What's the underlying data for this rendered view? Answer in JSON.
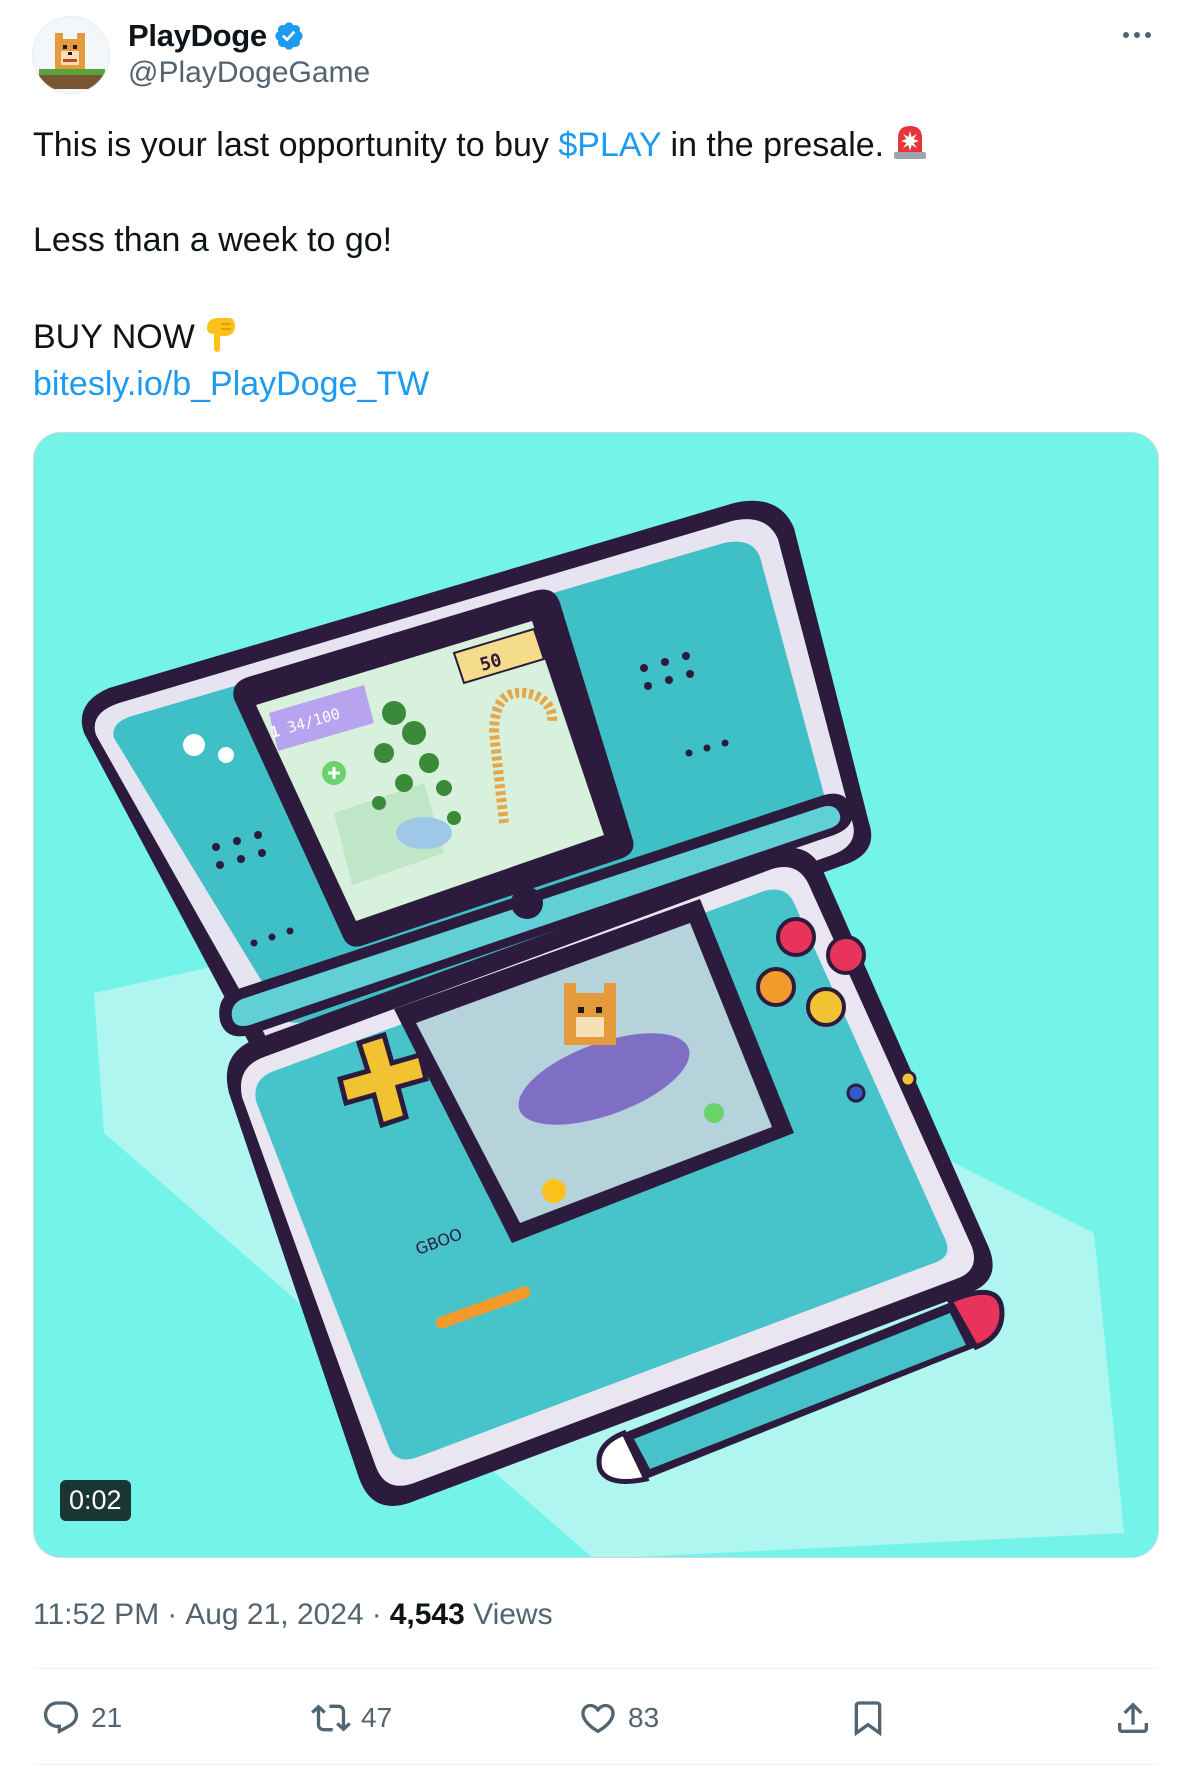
{
  "author": {
    "display_name": "PlayDoge",
    "handle": "@PlayDogeGame",
    "verified": true,
    "avatar_icon": "pixel-doge-avatar"
  },
  "post": {
    "line1_before": "This is your last opportunity to buy ",
    "line1_cashtag": "$PLAY",
    "line1_after": " in the presale.",
    "line1_emoji": "rotating-light-icon",
    "line2": "Less than a week to go!",
    "line3": "BUY NOW",
    "line3_emoji": "pointing-down-icon",
    "link": "bitesly.io/b_PlayDoge_TW"
  },
  "media": {
    "type": "video",
    "duration": "0:02",
    "screen_top_score": "50",
    "screen_top_progress": "34/100",
    "screen_top_level": "1",
    "device_label": "GBOO"
  },
  "meta": {
    "time": "11:52 PM",
    "separator": "·",
    "date": "Aug 21, 2024",
    "views_count": "4,543",
    "views_label": "Views"
  },
  "actions": {
    "replies": "21",
    "reposts": "47",
    "likes": "83"
  },
  "colors": {
    "link": "#1d9bf0",
    "secondary_text": "#536471",
    "media_background": "#74f3e8",
    "verified": "#1d9bf0"
  }
}
